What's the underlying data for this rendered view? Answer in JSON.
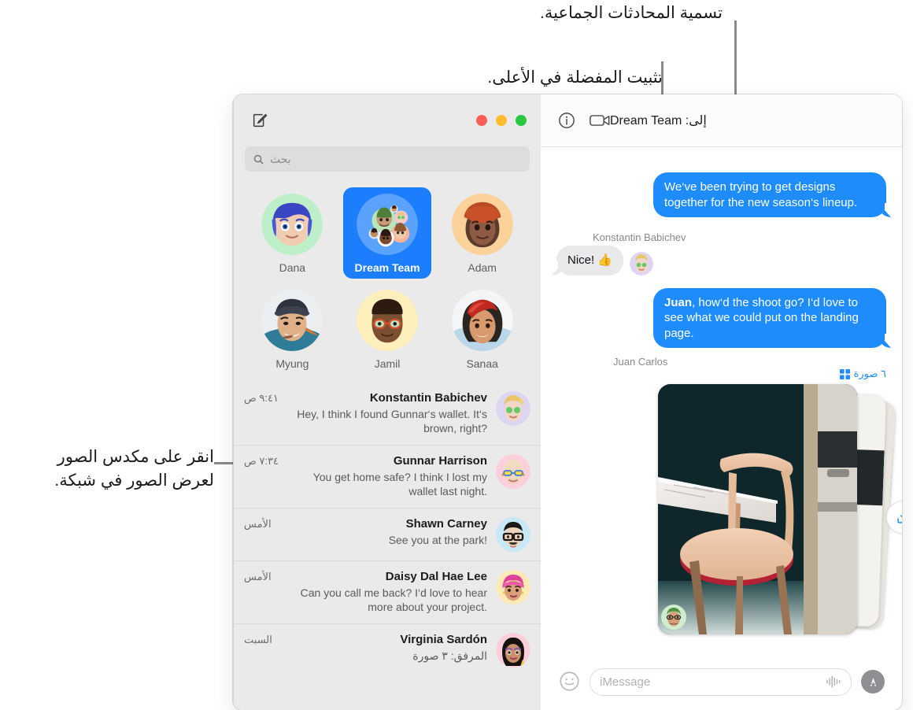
{
  "annotations": {
    "group_name": "تسمية المحادثات الجماعية.",
    "pin_top": "تثبيت المفضلة في الأعلى.",
    "photo_stack": "انقر على مكدس الصور\nلعرض الصور في شبكة."
  },
  "sidebar": {
    "compose_icon": "compose-icon",
    "traffic_lights": [
      "green",
      "yellow",
      "red"
    ],
    "search": {
      "placeholder": "بحث",
      "icon": "search-icon"
    },
    "pinned": [
      {
        "name": "Adam",
        "selected": false
      },
      {
        "name": "Dream Team",
        "selected": true
      },
      {
        "name": "Dana",
        "selected": false
      },
      {
        "name": "Sanaa",
        "selected": false
      },
      {
        "name": "Jamil",
        "selected": false
      },
      {
        "name": "Myung",
        "selected": false
      }
    ],
    "conversations": [
      {
        "name": "Konstantin Babichev",
        "preview": "Hey, I think I found Gunnar‘s wallet. It‘s brown, right?",
        "time": "٩:٤١ ص",
        "rtl": false
      },
      {
        "name": "Gunnar Harrison",
        "preview": "You get home safe? I think I lost my wallet last night.",
        "time": "٧:٣٤ ص",
        "rtl": false
      },
      {
        "name": "Shawn Carney",
        "preview": "See you at the park!",
        "time": "الأمس",
        "rtl": false
      },
      {
        "name": "Daisy Dal Hae Lee",
        "preview": "Can you call me back? I‘d love to hear more about your project.",
        "time": "الأمس",
        "rtl": false
      },
      {
        "name": "Virginia Sardón",
        "preview": "المرفق:  ٣ صورة",
        "time": "السبت",
        "rtl": true
      }
    ]
  },
  "conversation": {
    "title_prefix": "إلى:",
    "title_name": "Dream Team",
    "info_icon": "info-icon",
    "video_icon": "video-camera-icon",
    "messages": [
      {
        "type": "outgoing",
        "text": "We‘ve been trying to get designs together for the new season‘s lineup."
      },
      {
        "type": "incoming",
        "sender": "Konstantin Babichev",
        "text": "Nice!  👍"
      },
      {
        "type": "outgoing",
        "text_bold": "Juan",
        "text": ", how‘d the shoot go? I‘d love to see what we could put on the landing page."
      }
    ],
    "photo_stack": {
      "sender": "Juan Carlos",
      "count_label": "٦ صورة",
      "grid_icon": "grid-icon",
      "save_icon": "save-download-icon"
    },
    "input": {
      "placeholder": "iMessage",
      "apps_icon": "app-store-icon",
      "audio_icon": "audio-waveform-icon",
      "emoji_icon": "emoji-smiley-icon"
    }
  },
  "colors": {
    "accent_blue": "#1f8cfd",
    "selected_blue": "#1d7efd",
    "sidebar_bg": "#ebeaea",
    "gray_bubble": "#e9e9eb"
  }
}
